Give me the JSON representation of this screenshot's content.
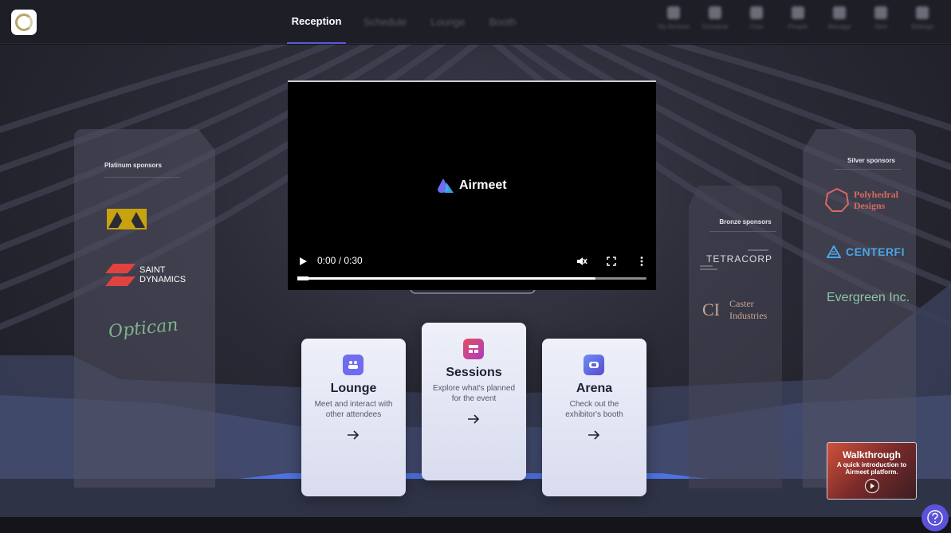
{
  "header": {
    "tabs": [
      {
        "label": "Reception",
        "active": true
      },
      {
        "label": "Schedule"
      },
      {
        "label": "Lounge"
      },
      {
        "label": "Booth"
      }
    ],
    "tools": [
      {
        "label": "My Airmeet",
        "icon": "home-icon"
      },
      {
        "label": "Schedule",
        "icon": "calendar-icon"
      },
      {
        "label": "Chat",
        "icon": "chat-icon"
      },
      {
        "label": "People",
        "icon": "people-icon"
      },
      {
        "label": "Manage",
        "icon": "settings-icon"
      },
      {
        "label": "Alert",
        "icon": "bell-icon"
      },
      {
        "label": "Settings",
        "icon": "gear-icon"
      }
    ]
  },
  "sponsors": {
    "platinum": {
      "title": "Platinum sponsors",
      "saint_dynamics": [
        "SAINT",
        "DYNAMICS"
      ],
      "optican": "Optican"
    },
    "silver": {
      "title": "Silver sponsors",
      "polyhedral": [
        "Polyhedral",
        "Designs"
      ],
      "centerfi": "CENTERFI",
      "evergreen": "Evergreen Inc."
    },
    "bronze": {
      "title": "Bronze sponsors",
      "tetracorp": "TETRACORP",
      "caster_ci": "CI",
      "caster": [
        "Caster",
        "Industries"
      ]
    }
  },
  "video": {
    "brand": "Airmeet",
    "time": "0:00 / 0:30",
    "progress": 0.853,
    "muted": true
  },
  "cards": [
    {
      "title": "Lounge",
      "desc": "Meet and interact with other attendees",
      "icon": "lounge-people-icon",
      "color": "#6f6cf0"
    },
    {
      "title": "Sessions",
      "desc": "Explore what's planned for the event",
      "icon": "sessions-stage-icon",
      "color": "#d9466f"
    },
    {
      "title": "Arena",
      "desc": "Check out the exhibitor's booth",
      "icon": "arena-booth-icon",
      "color": "#6b8ff0"
    }
  ],
  "walkthrough": {
    "title": "Walkthrough",
    "subtitle": "A quick introduction to Airmeet platform."
  },
  "colors": {
    "accent": "#5b52d9",
    "topbar": "#1e1e26"
  }
}
